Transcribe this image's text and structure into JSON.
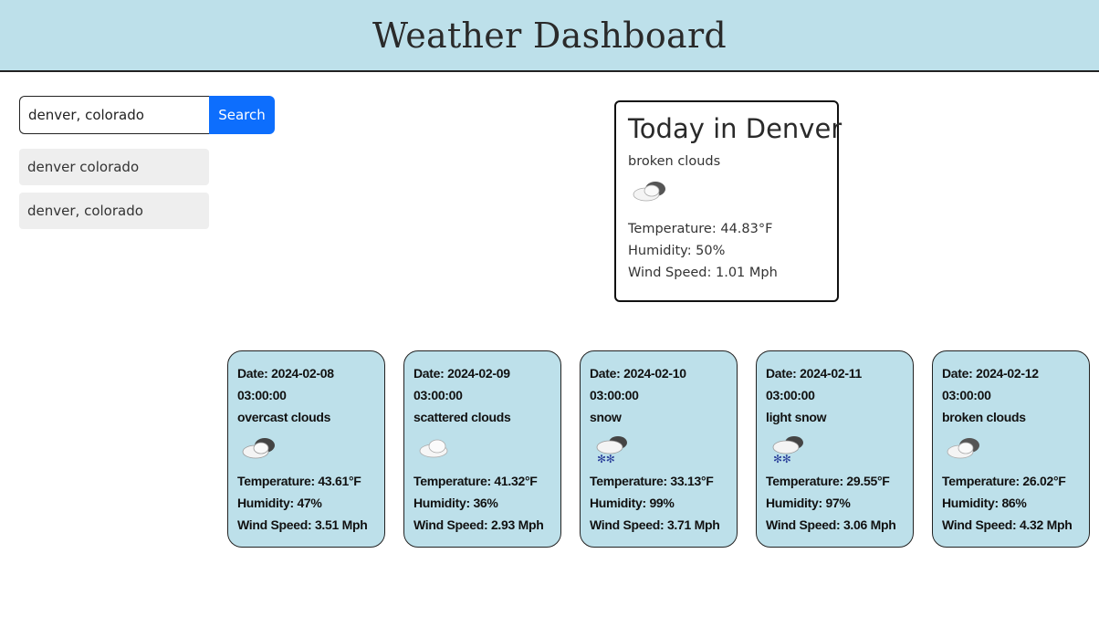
{
  "header": {
    "title": "Weather Dashboard"
  },
  "search": {
    "input_value": "denver, colorado",
    "button_label": "Search"
  },
  "history": [
    {
      "label": "denver colorado"
    },
    {
      "label": "denver, colorado"
    }
  ],
  "today": {
    "title": "Today in Denver",
    "description": "broken clouds",
    "icon": "broken-clouds-icon",
    "temperature": "Temperature: 44.83°F",
    "humidity": "Humidity: 50%",
    "wind": "Wind Speed: 1.01 Mph"
  },
  "forecast": [
    {
      "date": "Date: 2024-02-08",
      "time": "03:00:00",
      "description": "overcast clouds",
      "icon": "overcast-clouds-icon",
      "temperature": "Temperature: 43.61°F",
      "humidity": "Humidity: 47%",
      "wind": "Wind Speed: 3.51 Mph"
    },
    {
      "date": "Date: 2024-02-09",
      "time": "03:00:00",
      "description": "scattered clouds",
      "icon": "scattered-clouds-icon",
      "temperature": "Temperature: 41.32°F",
      "humidity": "Humidity: 36%",
      "wind": "Wind Speed: 2.93 Mph"
    },
    {
      "date": "Date: 2024-02-10",
      "time": "03:00:00",
      "description": "snow",
      "icon": "snow-icon",
      "temperature": "Temperature: 33.13°F",
      "humidity": "Humidity: 99%",
      "wind": "Wind Speed: 3.71 Mph"
    },
    {
      "date": "Date: 2024-02-11",
      "time": "03:00:00",
      "description": "light snow",
      "icon": "light-snow-icon",
      "temperature": "Temperature: 29.55°F",
      "humidity": "Humidity: 97%",
      "wind": "Wind Speed: 3.06 Mph"
    },
    {
      "date": "Date: 2024-02-12",
      "time": "03:00:00",
      "description": "broken clouds",
      "icon": "broken-clouds-icon",
      "temperature": "Temperature: 26.02°F",
      "humidity": "Humidity: 86%",
      "wind": "Wind Speed: 4.32 Mph"
    }
  ]
}
